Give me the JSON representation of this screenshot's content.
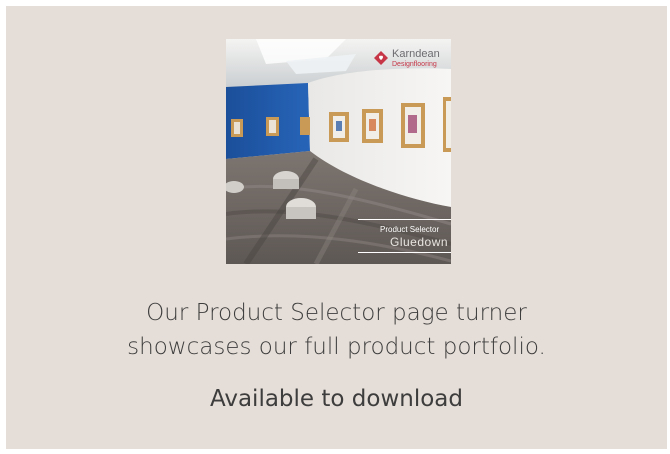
{
  "cover": {
    "brand_name": "Karndean",
    "brand_sub": "Designflooring",
    "selector_title": "Product Selector",
    "selector_sub": "Gluedown"
  },
  "body": {
    "line1": "Our Product Selector page turner",
    "line2": "showcases our full product portfolio.",
    "cta": "Available to download"
  },
  "colors": {
    "background": "#e5ddd7",
    "text": "#3d3d3d",
    "brand_red": "#c63647",
    "gallery_blue": "#1f5aa8"
  }
}
